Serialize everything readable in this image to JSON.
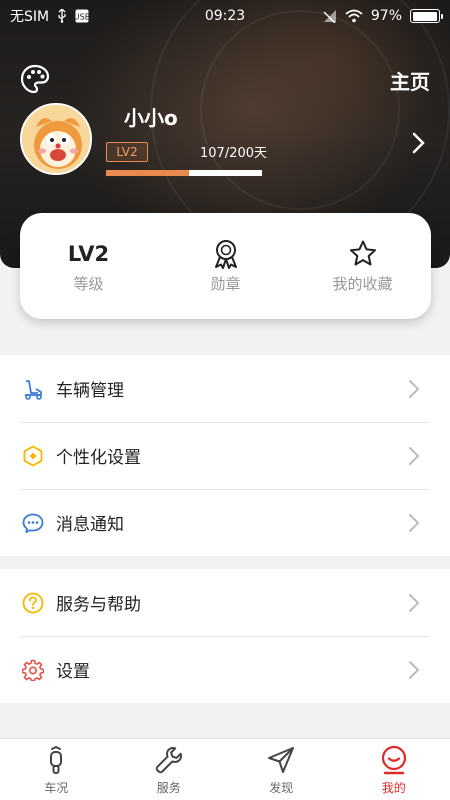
{
  "status_bar": {
    "carrier": "无SIM",
    "time": "09:23",
    "battery": "97%",
    "battery_level": 0.97
  },
  "header": {
    "home_link": "主页",
    "username": "小小o",
    "level_badge": "LV2",
    "progress_text": "107/200天",
    "progress_value": 107,
    "progress_max": 200
  },
  "stats": [
    {
      "value": "LV2",
      "label": "等级"
    },
    {
      "icon": "medal-icon",
      "label": "勋章"
    },
    {
      "icon": "star-icon",
      "label": "我的收藏"
    }
  ],
  "menu": {
    "group1": [
      {
        "icon": "scooter-icon",
        "label": "车辆管理"
      },
      {
        "icon": "hexagon-icon",
        "label": "个性化设置"
      },
      {
        "icon": "message-icon",
        "label": "消息通知"
      }
    ],
    "group2": [
      {
        "icon": "help-icon",
        "label": "服务与帮助"
      },
      {
        "icon": "gear-icon",
        "label": "设置"
      }
    ]
  },
  "tabs": [
    {
      "label": "车况",
      "icon": "scooter-icon"
    },
    {
      "label": "服务",
      "icon": "wrench-icon"
    },
    {
      "label": "发现",
      "icon": "navigation-icon"
    },
    {
      "label": "我的",
      "icon": "profile-icon",
      "active": true
    }
  ],
  "colors": {
    "accent": "#e88a4f",
    "active_tab": "#e02a2a",
    "blue_icon": "#3a7bd5",
    "yellow_icon": "#f5b800",
    "red_icon": "#e8524a"
  }
}
